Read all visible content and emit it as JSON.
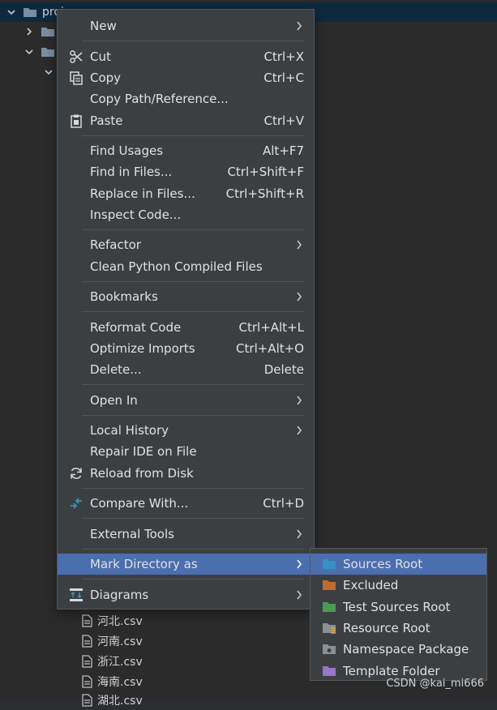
{
  "tree": {
    "root_label": "proj",
    "files": [
      "河北.csv",
      "河南.csv",
      "浙江.csv",
      "海南.csv",
      "湖北.csv"
    ]
  },
  "menu": {
    "items": [
      {
        "label": "New",
        "shortcut": "",
        "submenu": true,
        "icon": ""
      },
      {
        "label": "Cut",
        "shortcut": "Ctrl+X",
        "submenu": false,
        "icon": "scissors-icon"
      },
      {
        "label": "Copy",
        "shortcut": "Ctrl+C",
        "submenu": false,
        "icon": "copy-icon"
      },
      {
        "label": "Copy Path/Reference...",
        "shortcut": "",
        "submenu": false,
        "icon": ""
      },
      {
        "label": "Paste",
        "shortcut": "Ctrl+V",
        "submenu": false,
        "icon": "paste-icon"
      },
      {
        "label": "Find Usages",
        "shortcut": "Alt+F7",
        "submenu": false,
        "icon": ""
      },
      {
        "label": "Find in Files...",
        "shortcut": "Ctrl+Shift+F",
        "submenu": false,
        "icon": ""
      },
      {
        "label": "Replace in Files...",
        "shortcut": "Ctrl+Shift+R",
        "submenu": false,
        "icon": ""
      },
      {
        "label": "Inspect Code...",
        "shortcut": "",
        "submenu": false,
        "icon": ""
      },
      {
        "label": "Refactor",
        "shortcut": "",
        "submenu": true,
        "icon": ""
      },
      {
        "label": "Clean Python Compiled Files",
        "shortcut": "",
        "submenu": false,
        "icon": ""
      },
      {
        "label": "Bookmarks",
        "shortcut": "",
        "submenu": true,
        "icon": ""
      },
      {
        "label": "Reformat Code",
        "shortcut": "Ctrl+Alt+L",
        "submenu": false,
        "icon": ""
      },
      {
        "label": "Optimize Imports",
        "shortcut": "Ctrl+Alt+O",
        "submenu": false,
        "icon": ""
      },
      {
        "label": "Delete...",
        "shortcut": "Delete",
        "submenu": false,
        "icon": ""
      },
      {
        "label": "Open In",
        "shortcut": "",
        "submenu": true,
        "icon": ""
      },
      {
        "label": "Local History",
        "shortcut": "",
        "submenu": true,
        "icon": ""
      },
      {
        "label": "Repair IDE on File",
        "shortcut": "",
        "submenu": false,
        "icon": ""
      },
      {
        "label": "Reload from Disk",
        "shortcut": "",
        "submenu": false,
        "icon": "reload-icon"
      },
      {
        "label": "Compare With...",
        "shortcut": "Ctrl+D",
        "submenu": false,
        "icon": "compare-icon"
      },
      {
        "label": "External Tools",
        "shortcut": "",
        "submenu": true,
        "icon": ""
      },
      {
        "label": "Mark Directory as",
        "shortcut": "",
        "submenu": true,
        "icon": ""
      },
      {
        "label": "Diagrams",
        "shortcut": "",
        "submenu": true,
        "icon": "diagram-icon"
      }
    ]
  },
  "submenu": {
    "items": [
      {
        "label": "Sources Root",
        "color": "#3592c4"
      },
      {
        "label": "Excluded",
        "color": "#c36b2d"
      },
      {
        "label": "Test Sources Root",
        "color": "#499c54"
      },
      {
        "label": "Resource Root",
        "color": "#8a8f94"
      },
      {
        "label": "Namespace Package",
        "color": "#8a8f94"
      },
      {
        "label": "Template Folder",
        "color": "#9876c9"
      }
    ]
  },
  "colors": {
    "highlight": "#4b6eaf",
    "menu_bg": "#3c3f41"
  },
  "watermark": "CSDN @kai_mi666"
}
